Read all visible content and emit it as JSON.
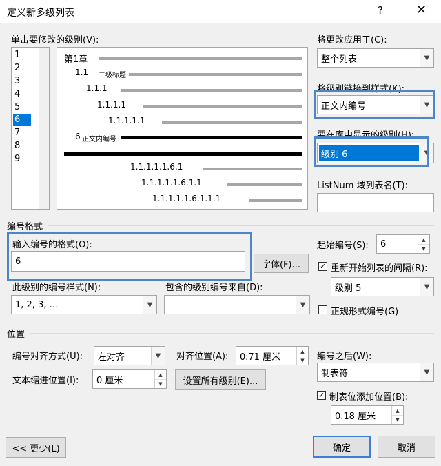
{
  "dialog": {
    "title": "定义新多级列表",
    "help": "?",
    "close": "✕"
  },
  "level_select": {
    "label": "单击要修改的级别(V):",
    "levels": [
      "1",
      "2",
      "3",
      "4",
      "5",
      "6",
      "7",
      "8",
      "9"
    ],
    "selected": "6"
  },
  "preview": {
    "lines": [
      "第1章",
      "1.1",
      "二级标题",
      "1.1.1",
      "1.1.1.1",
      "1.1.1.1.1",
      "6",
      "正文内编号",
      "1.1.1.1.1.6.1",
      "1.1.1.1.1.6.1.1",
      "1.1.1.1.1.6.1.1.1"
    ]
  },
  "right_top": {
    "apply_label": "将更改应用于(C):",
    "apply_value": "整个列表",
    "link_style_label": "将级别链接到样式(K):",
    "link_style_value": "正文内编号",
    "gallery_level_label": "要在库中显示的级别(H):",
    "gallery_level_value": "级别 6",
    "listnum_label": "ListNum 域列表名(T):",
    "listnum_value": ""
  },
  "number_format": {
    "group_label": "编号格式",
    "enter_format_label": "输入编号的格式(O):",
    "format_value": "6",
    "font_button": "字体(F)...",
    "style_label": "此级别的编号样式(N):",
    "style_value": "1, 2, 3, …",
    "include_label": "包含的级别编号来自(D):",
    "include_value": "",
    "start_at_label": "起始编号(S):",
    "start_at_value": "6",
    "restart_label": "重新开始列表的间隔(R):",
    "restart_checked": true,
    "restart_value": "级别 5",
    "legal_label": "正规形式编号(G)",
    "legal_checked": false
  },
  "position": {
    "group_label": "位置",
    "alignment_label": "编号对齐方式(U):",
    "alignment_value": "左对齐",
    "aligned_at_label": "对齐位置(A):",
    "aligned_at_value": "0.71 厘米",
    "indent_label": "文本缩进位置(I):",
    "indent_value": "0 厘米",
    "set_all_button": "设置所有级别(E)...",
    "follow_label": "编号之后(W):",
    "follow_value": "制表符",
    "tab_stop_label": "制表位添加位置(B):",
    "tab_stop_checked": true,
    "tab_stop_value": "0.18 厘米"
  },
  "footer": {
    "less_button": "<< 更少(L)",
    "ok_button": "确定",
    "cancel_button": "取消"
  },
  "colors": {
    "highlight": "#4a86c8",
    "selection": "#0078d7"
  }
}
